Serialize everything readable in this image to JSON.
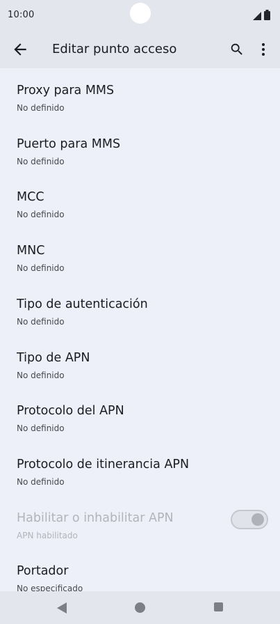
{
  "status_bar": {
    "time": "10:00"
  },
  "app_bar": {
    "title": "Editar punto acceso"
  },
  "items": [
    {
      "title": "Proxy para MMS",
      "summary": "No definido"
    },
    {
      "title": "Puerto para MMS",
      "summary": "No definido"
    },
    {
      "title": "MCC",
      "summary": "No definido"
    },
    {
      "title": "MNC",
      "summary": "No definido"
    },
    {
      "title": "Tipo de autenticación",
      "summary": "No definido"
    },
    {
      "title": "Tipo de APN",
      "summary": "No definido"
    },
    {
      "title": "Protocolo del APN",
      "summary": "No definido"
    },
    {
      "title": "Protocolo de itinerancia APN",
      "summary": "No definido"
    },
    {
      "title": "Habilitar o inhabilitar APN",
      "summary": "APN habilitado",
      "toggle_on": true,
      "enabled": false
    },
    {
      "title": "Portador",
      "summary": "No especificado"
    }
  ],
  "icons": {
    "back": "arrow-back-icon",
    "search": "search-icon",
    "more": "more-vert-icon",
    "nav_back": "triangle-back-icon",
    "nav_home": "circle-home-icon",
    "nav_recents": "square-recents-icon"
  },
  "colors": {
    "background": "#edf0f8",
    "app_bar": "#e4e6ee",
    "text_primary": "#1b1c20",
    "text_secondary": "#46474f",
    "text_disabled": "#b2b4bb"
  }
}
